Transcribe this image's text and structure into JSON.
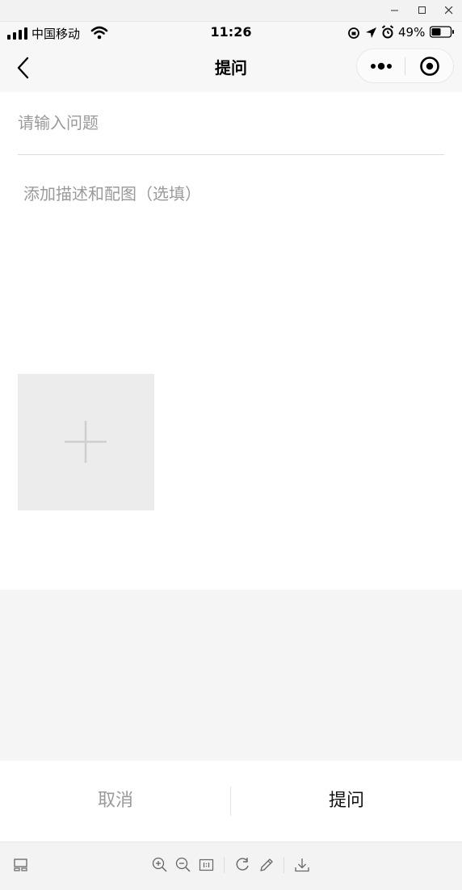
{
  "status_bar": {
    "carrier": "中国移动",
    "time": "11:26",
    "battery": "49%"
  },
  "nav": {
    "title": "提问"
  },
  "form": {
    "question_placeholder": "请输入问题",
    "description_placeholder": "添加描述和配图（选填）"
  },
  "actions": {
    "cancel_label": "取消",
    "submit_label": "提问"
  }
}
